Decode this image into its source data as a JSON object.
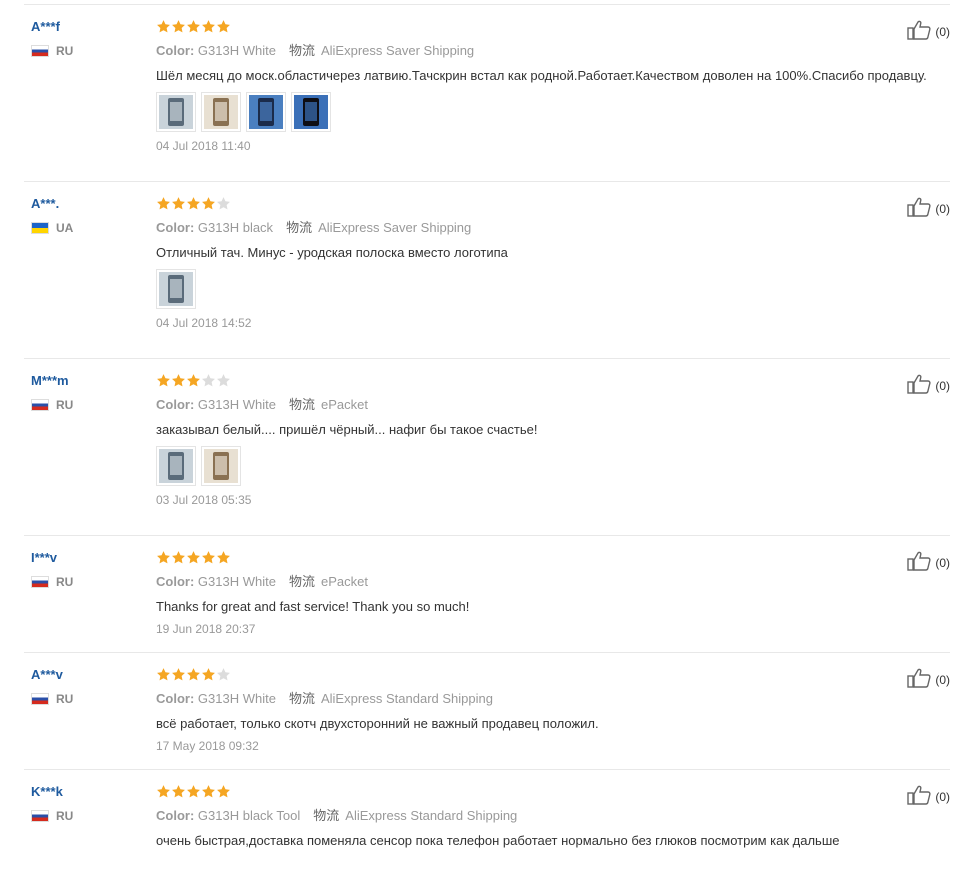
{
  "labels": {
    "color": "Color:",
    "ship_icon": "物流"
  },
  "colors": {
    "star_on": "#f5a623",
    "star_off": "#dcdcdc",
    "username": "#1e5a9e"
  },
  "reviews": [
    {
      "user": "A***f",
      "country": "RU",
      "flag": "ru",
      "rating": 5,
      "color": "G313H White",
      "shipping": "AliExpress Saver Shipping",
      "text": "Шёл месяц до моск.областичерез латвию.Тачскрин встал как родной.Работает.Качеством доволен на 100%.Спасибо продавцу.",
      "photos": [
        "photo-1",
        "photo-2",
        "photo-3",
        "photo-4"
      ],
      "date": "04 Jul 2018 11:40",
      "helpful": "(0)"
    },
    {
      "user": "A***.",
      "country": "UA",
      "flag": "ua",
      "rating": 4,
      "color": "G313H black",
      "shipping": "AliExpress Saver Shipping",
      "text": "Отличный тач. Минус - уродская полоска вместо логотипа",
      "photos": [
        "photo-1"
      ],
      "date": "04 Jul 2018 14:52",
      "helpful": "(0)"
    },
    {
      "user": "M***m",
      "country": "RU",
      "flag": "ru",
      "rating": 3,
      "color": "G313H White",
      "shipping": "ePacket",
      "text": "заказывал белый.... пришёл чёрный... нафиг бы такое счастье!",
      "photos": [
        "photo-1",
        "photo-2"
      ],
      "date": "03 Jul 2018 05:35",
      "helpful": "(0)"
    },
    {
      "user": "I***v",
      "country": "RU",
      "flag": "ru",
      "rating": 5,
      "color": "G313H White",
      "shipping": "ePacket",
      "text": "Thanks for great and fast service! Thank you so much!",
      "photos": [],
      "date": "19 Jun 2018 20:37",
      "helpful": "(0)"
    },
    {
      "user": "A***v",
      "country": "RU",
      "flag": "ru",
      "rating": 4,
      "color": "G313H White",
      "shipping": "AliExpress Standard Shipping",
      "text": "всё работает, только скотч двухсторонний не важный продавец положил.",
      "photos": [],
      "date": "17 May 2018 09:32",
      "helpful": "(0)"
    },
    {
      "user": "K***k",
      "country": "RU",
      "flag": "ru",
      "rating": 5,
      "color": "G313H black Tool",
      "shipping": "AliExpress Standard Shipping",
      "text": "очень быстрая,доставка поменяла сенсор пока телефон работает нормально без глюков посмотрим как дальше",
      "photos": [],
      "date": "",
      "helpful": "(0)"
    }
  ]
}
